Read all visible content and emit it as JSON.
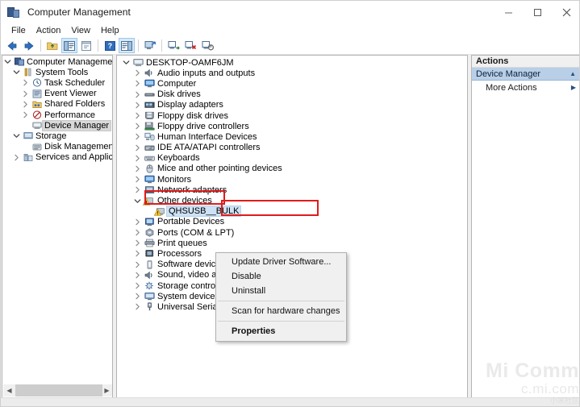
{
  "window": {
    "title": "Computer Management",
    "icon": "computer-management-icon",
    "controls": {
      "minimize": "minimize-icon",
      "maximize": "maximize-icon",
      "close": "close-icon"
    }
  },
  "menubar": {
    "items": [
      {
        "label": "File"
      },
      {
        "label": "Action"
      },
      {
        "label": "View"
      },
      {
        "label": "Help"
      }
    ]
  },
  "toolbar": {
    "buttons": [
      {
        "name": "back-button",
        "icon": "arrow-left-icon"
      },
      {
        "name": "forward-button",
        "icon": "arrow-right-icon"
      },
      {
        "name": "up-one-level-button",
        "icon": "folder-up-icon"
      },
      {
        "name": "show-hide-console-tree-button",
        "icon": "console-tree-icon",
        "selected": true
      },
      {
        "name": "export-list-button",
        "icon": "export-list-icon"
      },
      {
        "name": "help-button",
        "icon": "help-icon"
      },
      {
        "name": "show-hide-action-pane-button",
        "icon": "action-pane-icon",
        "selected": true
      },
      {
        "name": "scan-hardware-changes-button",
        "icon": "scan-hardware-icon"
      },
      {
        "name": "update-driver-button",
        "icon": "update-driver-icon"
      },
      {
        "name": "uninstall-device-button",
        "icon": "uninstall-device-icon"
      },
      {
        "name": "disable-device-button",
        "icon": "disable-device-icon"
      }
    ]
  },
  "console_tree": {
    "items": [
      {
        "label": "Computer Management (Local",
        "level": 0,
        "twist": "expanded",
        "icon": "computer-management-icon",
        "selected": false
      },
      {
        "label": "System Tools",
        "level": 1,
        "twist": "expanded",
        "icon": "tools-icon",
        "selected": false
      },
      {
        "label": "Task Scheduler",
        "level": 2,
        "twist": "collapsed",
        "icon": "clock-icon",
        "selected": false
      },
      {
        "label": "Event Viewer",
        "level": 2,
        "twist": "collapsed",
        "icon": "event-viewer-icon",
        "selected": false
      },
      {
        "label": "Shared Folders",
        "level": 2,
        "twist": "collapsed",
        "icon": "shared-folders-icon",
        "selected": false
      },
      {
        "label": "Performance",
        "level": 2,
        "twist": "collapsed",
        "icon": "performance-icon",
        "selected": false
      },
      {
        "label": "Device Manager",
        "level": 2,
        "twist": "none",
        "icon": "device-manager-icon",
        "selected": true
      },
      {
        "label": "Storage",
        "level": 1,
        "twist": "expanded",
        "icon": "storage-icon",
        "selected": false
      },
      {
        "label": "Disk Management",
        "level": 2,
        "twist": "none",
        "icon": "disk-management-icon",
        "selected": false
      },
      {
        "label": "Services and Applications",
        "level": 1,
        "twist": "collapsed",
        "icon": "services-icon",
        "selected": false
      }
    ],
    "scrollbar": {
      "left_arrow": "chevron-left-icon",
      "right_arrow": "chevron-right-icon"
    }
  },
  "device_tree": {
    "items": [
      {
        "label": "DESKTOP-OAMF6JM",
        "level": 0,
        "twist": "expanded",
        "icon": "computer-icon",
        "selected": false,
        "warning": false
      },
      {
        "label": "Audio inputs and outputs",
        "level": 1,
        "twist": "collapsed",
        "icon": "audio-icon",
        "selected": false,
        "warning": false
      },
      {
        "label": "Computer",
        "level": 1,
        "twist": "collapsed",
        "icon": "monitor-icon",
        "selected": false,
        "warning": false
      },
      {
        "label": "Disk drives",
        "level": 1,
        "twist": "collapsed",
        "icon": "disk-drive-icon",
        "selected": false,
        "warning": false
      },
      {
        "label": "Display adapters",
        "level": 1,
        "twist": "collapsed",
        "icon": "display-adapter-icon",
        "selected": false,
        "warning": false
      },
      {
        "label": "Floppy disk drives",
        "level": 1,
        "twist": "collapsed",
        "icon": "floppy-disk-icon",
        "selected": false,
        "warning": false
      },
      {
        "label": "Floppy drive controllers",
        "level": 1,
        "twist": "collapsed",
        "icon": "floppy-controller-icon",
        "selected": false,
        "warning": false
      },
      {
        "label": "Human Interface Devices",
        "level": 1,
        "twist": "collapsed",
        "icon": "hid-icon",
        "selected": false,
        "warning": false
      },
      {
        "label": "IDE ATA/ATAPI controllers",
        "level": 1,
        "twist": "collapsed",
        "icon": "ide-controller-icon",
        "selected": false,
        "warning": false
      },
      {
        "label": "Keyboards",
        "level": 1,
        "twist": "collapsed",
        "icon": "keyboard-icon",
        "selected": false,
        "warning": false
      },
      {
        "label": "Mice and other pointing devices",
        "level": 1,
        "twist": "collapsed",
        "icon": "mouse-icon",
        "selected": false,
        "warning": false
      },
      {
        "label": "Monitors",
        "level": 1,
        "twist": "collapsed",
        "icon": "monitor-icon",
        "selected": false,
        "warning": false
      },
      {
        "label": "Network adapters",
        "level": 1,
        "twist": "collapsed",
        "icon": "network-adapter-icon",
        "selected": false,
        "warning": false
      },
      {
        "label": "Other devices",
        "level": 1,
        "twist": "expanded",
        "icon": "other-devices-icon",
        "selected": false,
        "warning": true
      },
      {
        "label": "QHSUSB__BULK",
        "level": 2,
        "twist": "none",
        "icon": "unknown-device-icon",
        "selected": true,
        "warning": true
      },
      {
        "label": "Portable Devices",
        "level": 1,
        "twist": "collapsed",
        "icon": "portable-device-icon",
        "selected": false,
        "warning": false
      },
      {
        "label": "Ports (COM & LPT)",
        "level": 1,
        "twist": "collapsed",
        "icon": "ports-icon",
        "selected": false,
        "warning": false
      },
      {
        "label": "Print queues",
        "level": 1,
        "twist": "collapsed",
        "icon": "printer-icon",
        "selected": false,
        "warning": false
      },
      {
        "label": "Processors",
        "level": 1,
        "twist": "collapsed",
        "icon": "processor-icon",
        "selected": false,
        "warning": false
      },
      {
        "label": "Software devices",
        "level": 1,
        "twist": "collapsed",
        "icon": "software-device-icon",
        "selected": false,
        "warning": false
      },
      {
        "label": "Sound, video and",
        "level": 1,
        "twist": "collapsed",
        "icon": "sound-icon",
        "selected": false,
        "warning": false
      },
      {
        "label": "Storage controller",
        "level": 1,
        "twist": "collapsed",
        "icon": "storage-controller-icon",
        "selected": false,
        "warning": false
      },
      {
        "label": "System devices",
        "level": 1,
        "twist": "collapsed",
        "icon": "system-device-icon",
        "selected": false,
        "warning": false
      },
      {
        "label": "Universal Serial Bus controllers",
        "level": 1,
        "twist": "collapsed",
        "icon": "usb-icon",
        "selected": false,
        "warning": false
      }
    ]
  },
  "context_menu": {
    "items": [
      {
        "label": "Update Driver Software...",
        "bold": false,
        "highlighted": true
      },
      {
        "label": "Disable",
        "bold": false,
        "highlighted": false
      },
      {
        "label": "Uninstall",
        "bold": false,
        "highlighted": false
      },
      {
        "separator": true
      },
      {
        "label": "Scan for hardware changes",
        "bold": false,
        "highlighted": false
      },
      {
        "separator": true
      },
      {
        "label": "Properties",
        "bold": true,
        "highlighted": false
      }
    ]
  },
  "actions_pane": {
    "header": "Actions",
    "group": {
      "label": "Device Manager",
      "collapse_icon": "chevron-up-icon"
    },
    "items": [
      {
        "label": "More Actions",
        "submenu_icon": "chevron-right-icon"
      }
    ]
  },
  "annotations": {
    "device_highlight": {
      "target": "QHSUSB__BULK",
      "color": "#e01b1b"
    },
    "menu_highlight": {
      "target": "Update Driver Software...",
      "color": "#e01b1b"
    }
  },
  "watermark": {
    "line1": "Mi Comm",
    "line2": "c.mi.com",
    "line3": "小米社区"
  }
}
